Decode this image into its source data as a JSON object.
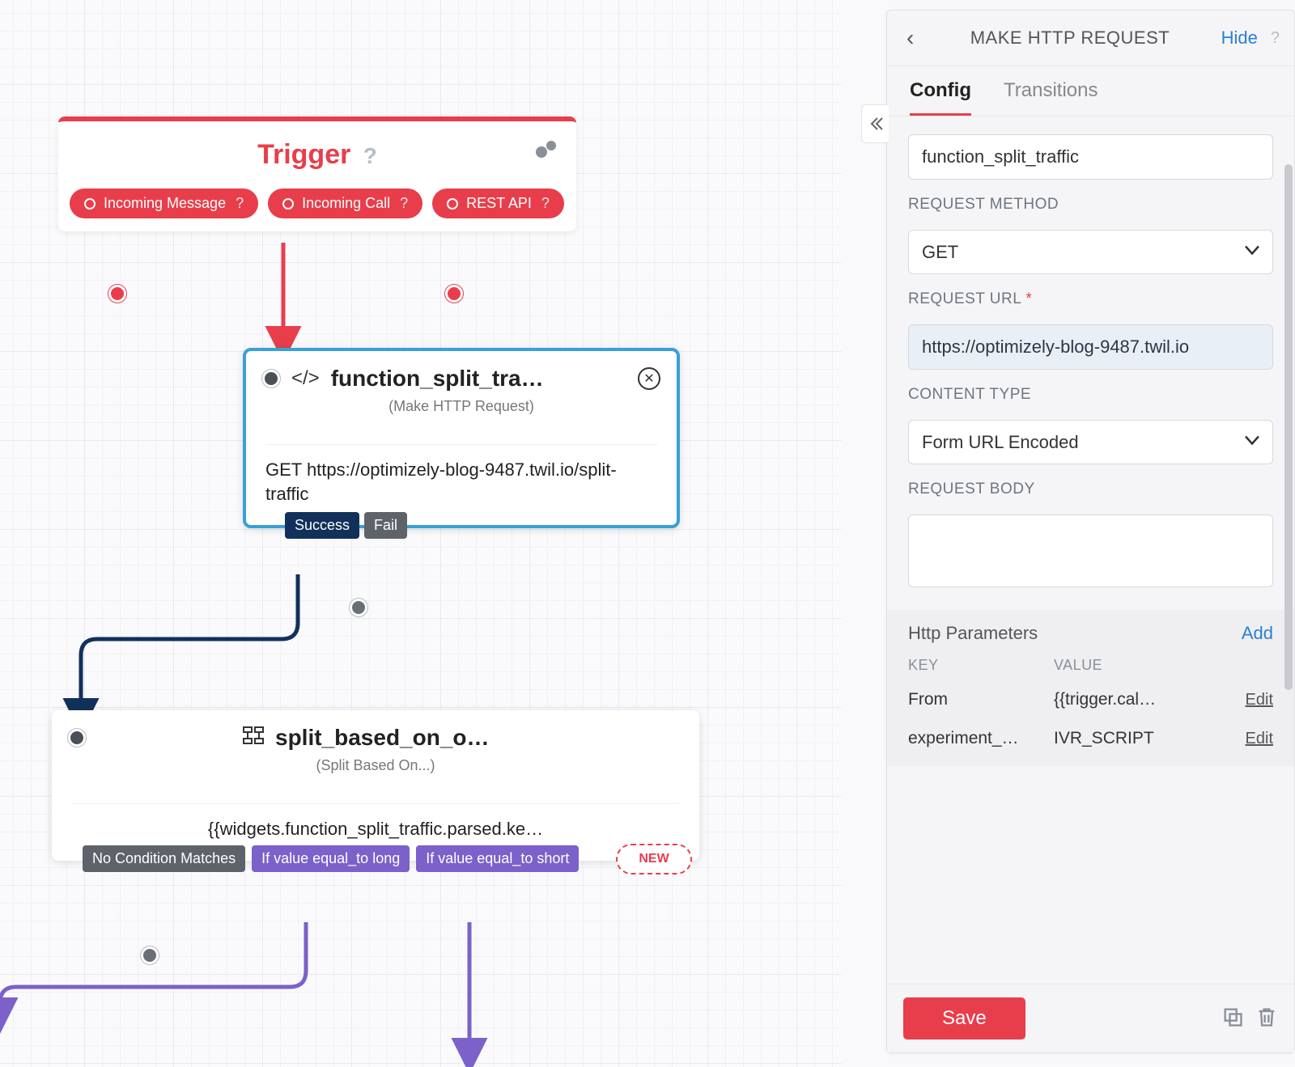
{
  "canvas": {
    "trigger": {
      "title": "Trigger",
      "pills": [
        {
          "label": "Incoming Message"
        },
        {
          "label": "Incoming Call"
        },
        {
          "label": "REST API"
        }
      ]
    },
    "http_node": {
      "title": "function_split_tra…",
      "subtitle": "(Make HTTP Request)",
      "body": "GET https://optimizely-blog-9487.twil.io/split-traffic",
      "tags": {
        "success": "Success",
        "fail": "Fail"
      }
    },
    "split_node": {
      "title": "split_based_on_o…",
      "subtitle": "(Split Based On...)",
      "body": "{{widgets.function_split_traffic.parsed.ke…",
      "tags": {
        "nomatch": "No Condition Matches",
        "long": "If value equal_to long",
        "short": "If value equal_to short",
        "new": "NEW"
      }
    }
  },
  "panel": {
    "title": "MAKE HTTP REQUEST",
    "hide": "Hide",
    "tabs": {
      "config": "Config",
      "transitions": "Transitions"
    },
    "name_value": "function_split_traffic",
    "method_label": "REQUEST METHOD",
    "method_value": "GET",
    "url_label": "REQUEST URL",
    "url_value": "https://optimizely-blog-9487.twil.io",
    "ctype_label": "CONTENT TYPE",
    "ctype_value": "Form URL Encoded",
    "body_label": "REQUEST BODY",
    "body_value": "",
    "params": {
      "title": "Http Parameters",
      "add": "Add",
      "col_key": "KEY",
      "col_val": "VALUE",
      "edit": "Edit",
      "rows": [
        {
          "key": "From",
          "val": "{{trigger.cal…"
        },
        {
          "key": "experiment_…",
          "val": "IVR_SCRIPT"
        }
      ]
    },
    "save": "Save"
  }
}
